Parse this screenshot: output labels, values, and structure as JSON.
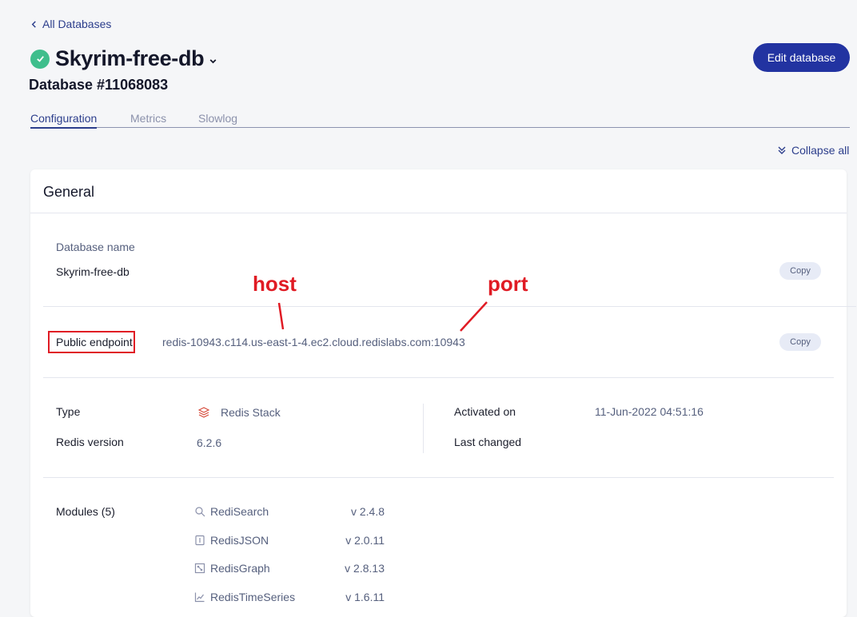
{
  "nav": {
    "back_label": "All Databases"
  },
  "header": {
    "title": "Skyrim-free-db",
    "subtitle": "Database #11068083",
    "edit_label": "Edit database"
  },
  "tabs": [
    {
      "label": "Configuration",
      "active": true
    },
    {
      "label": "Metrics",
      "active": false
    },
    {
      "label": "Slowlog",
      "active": false
    }
  ],
  "collapse_label": "Collapse all",
  "general": {
    "title": "General",
    "db_name_label": "Database name",
    "db_name_value": "Skyrim-free-db",
    "copy_label": "Copy",
    "endpoint_label": "Public endpoint",
    "endpoint_value": "redis-10943.c114.us-east-1-4.ec2.cloud.redislabs.com:10943",
    "annotations": {
      "host": "host",
      "port": "port"
    },
    "type_label": "Type",
    "type_value": "Redis Stack",
    "version_label": "Redis version",
    "version_value": "6.2.6",
    "activated_label": "Activated on",
    "activated_value": "11-Jun-2022 04:51:16",
    "changed_label": "Last changed",
    "changed_value": "",
    "modules_label": "Modules (5)",
    "modules": [
      {
        "name": "RediSearch",
        "version": "v 2.4.8",
        "icon": "search-module-icon"
      },
      {
        "name": "RedisJSON",
        "version": "v 2.0.11",
        "icon": "json-module-icon"
      },
      {
        "name": "RedisGraph",
        "version": "v 2.8.13",
        "icon": "graph-module-icon"
      },
      {
        "name": "RedisTimeSeries",
        "version": "v 1.6.11",
        "icon": "timeseries-module-icon"
      }
    ]
  },
  "colors": {
    "accent": "#2233a1",
    "status_ok": "#3fbe8c",
    "annotation": "#e01b24"
  }
}
